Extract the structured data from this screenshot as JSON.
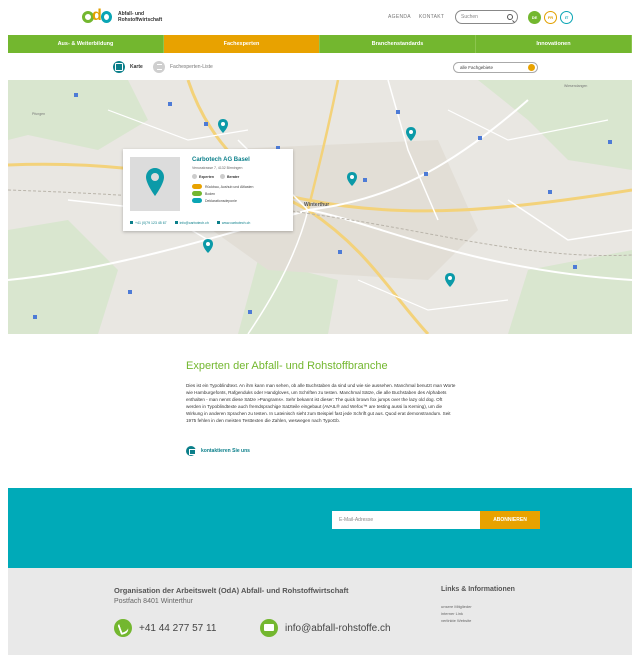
{
  "header": {
    "logo_line1": "Abfall- und",
    "logo_line2": "Rohstoffwirtschaft",
    "nav": [
      "AGENDA",
      "KONTAKT"
    ],
    "search_placeholder": "Suchen",
    "languages": [
      "DE",
      "FR",
      "IT"
    ]
  },
  "mainnav": {
    "items": [
      "Aus- & Weiterbildung",
      "Fachexperten",
      "Branchenstandards",
      "Innovationen"
    ],
    "active_index": 1
  },
  "subbar": {
    "view_map": "Karte",
    "view_list": "Fachexperten-Liste",
    "filter_value": "alle Fachgebiete"
  },
  "map": {
    "labels": {
      "winterthur": "Winterthur",
      "wiesendangen": "Wiesendangen",
      "pfungen": "Pfungen"
    },
    "card": {
      "name": "Carbotech AG Basel",
      "address": "Venusstrasse 7, 4132 Birmingen",
      "badge1": "Experten",
      "badge2": "Berater",
      "tags": [
        "Rückbau, Aushub und Altlasten",
        "Boden",
        "Deklarationsdeponie"
      ],
      "phone": "+41 (0)79 123 45 67",
      "email": "info@carbotech.ch",
      "web": "www.carbotech.ch"
    }
  },
  "content": {
    "title": "Experten der Abfall- und Rohstoffbranche",
    "body": "Dies ist ein Typoblindtext. An ihm kann man sehen, ob alle Buchstaben da sind und wie sie aussehen. Manchmal benutzt man Worte wie Hamburgefonts, Rafgenduks oder Handgloves, um Schriften zu testen. Manchmal Sätze, die alle Buchstaben des Alphabets enthalten - man nennt diese Sätze »Pangrams«. Sehr bekannt ist dieser: The quick brown fox jumps over the lazy old dog. Oft werden in Typoblindtexte auch fremdsprachige Satzteile eingebaut (AVAIL® and Wefox™ are testing aussi la Kerning), um die Wirkung in anderen Sprachen zu testen. In Lateinisch sieht zum Beispiel fast jede Schrift gut aus. Quod erat demonstrandum. Seit 1975 fehlen in den meisten Testtexten die Zahlen, weswegen nach TypoGb.",
    "contact_link": "kontaktieren Sie uns"
  },
  "newsletter": {
    "email_placeholder": "E-Mail-Adresse",
    "button": "ABONNIEREN"
  },
  "footer": {
    "org": "Organisation der Arbeitswelt (OdA) Abfall- und Rohstoffwirtschaft",
    "address": "Postfach 8401 Winterthur",
    "phone": "+41 44 277 57 11",
    "email": "info@abfall-rohstoffe.ch",
    "links_title": "Links & Informationen",
    "links": [
      "unsere Mitglieder",
      "interner Link",
      "verlinkte Website"
    ]
  },
  "colors": {
    "green": "#73b72f",
    "orange": "#e8a200",
    "teal": "#00aab8",
    "dark_teal": "#0b7f8a"
  }
}
